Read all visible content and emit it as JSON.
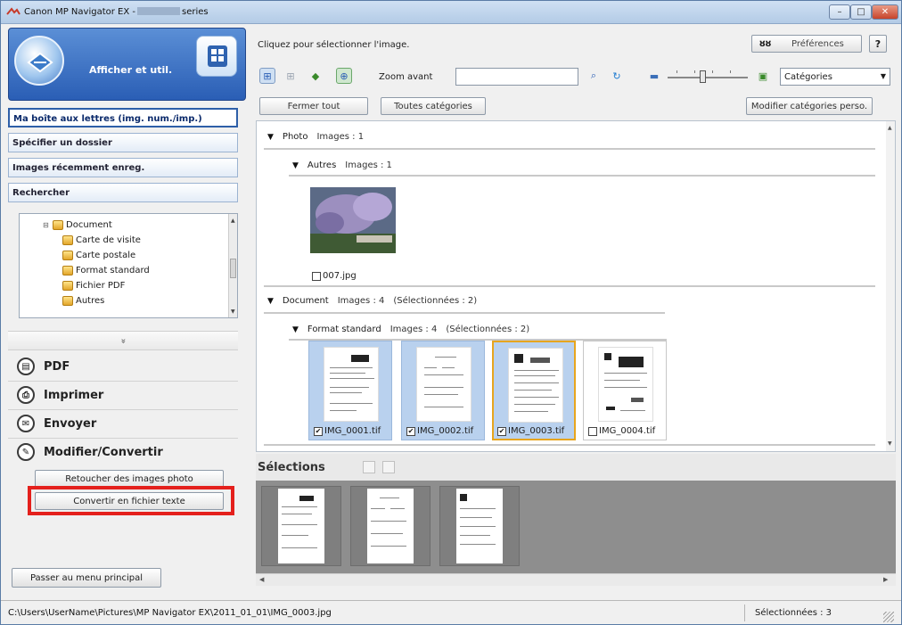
{
  "window": {
    "title_prefix": "Canon MP Navigator EX -",
    "title_suffix": "series"
  },
  "left": {
    "header_label": "Afficher et util.",
    "nav": [
      "Ma boîte aux lettres (img. num./imp.)",
      "Spécifier un dossier",
      "Images récemment enreg.",
      "Rechercher"
    ],
    "tree": {
      "root": "Document",
      "children": [
        "Carte de visite",
        "Carte postale",
        "Format standard",
        "Fichier PDF",
        "Autres"
      ]
    },
    "collapse_glyph": "»",
    "actions": [
      "PDF",
      "Imprimer",
      "Envoyer",
      "Modifier/Convertir"
    ],
    "sub_actions": [
      "Retoucher des images photo",
      "Convertir en fichier texte"
    ],
    "main_menu_button": "Passer au menu principal"
  },
  "right": {
    "hint": "Cliquez pour sélectionner l'image.",
    "preferences_label": "Préférences",
    "preferences_icon": "ȣȣ",
    "help_label": "?",
    "zoom_label": "Zoom avant",
    "search_value": "",
    "category_select": "Catégories",
    "buttons": {
      "close_all": "Fermer tout",
      "all_categories": "Toutes catégories",
      "edit_categories": "Modifier catégories perso."
    },
    "groups": {
      "photo": {
        "name": "Photo",
        "count": "Images : 1"
      },
      "autres": {
        "name": "Autres",
        "count": "Images : 1"
      },
      "document": {
        "name": "Document",
        "count": "Images : 4",
        "selected": "(Sélectionnées : 2)"
      },
      "format_standard": {
        "name": "Format standard",
        "count": "Images : 4",
        "selected": "(Sélectionnées : 2)"
      }
    },
    "photo_file": "007.jpg",
    "documents": [
      {
        "name": "IMG_0001.tif",
        "checked": true
      },
      {
        "name": "IMG_0002.tif",
        "checked": true
      },
      {
        "name": "IMG_0003.tif",
        "checked": true
      },
      {
        "name": "IMG_0004.tif",
        "checked": false
      }
    ],
    "selections_label": "Sélections"
  },
  "status": {
    "path": "C:\\Users\\UserName\\Pictures\\MP Navigator EX\\2011_01_01\\IMG_0003.jpg",
    "selected_count": "Sélectionnées : 3"
  },
  "colors": {
    "highlight_red": "#e4201c",
    "selected_blue": "#b9d1ee",
    "current_orange": "#e7a51e",
    "header_blue": "#2a5eb5"
  }
}
